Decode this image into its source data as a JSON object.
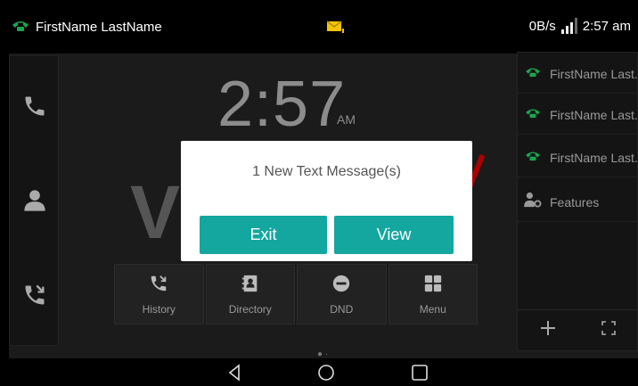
{
  "status_bar": {
    "account_name": "FirstName LastName",
    "net_speed": "0B/s",
    "time": "2:57 am"
  },
  "clock": {
    "time": "2:57",
    "ampm": "AM"
  },
  "dock": {
    "items": [
      {
        "label": "History",
        "icon": "history-icon"
      },
      {
        "label": "Directory",
        "icon": "directory-icon"
      },
      {
        "label": "DND",
        "icon": "dnd-icon"
      },
      {
        "label": "Menu",
        "icon": "menu-icon"
      }
    ]
  },
  "right_panel": {
    "line_keys": [
      {
        "label": "FirstName Last..."
      },
      {
        "label": "FirstName Last..."
      },
      {
        "label": "FirstName Last..."
      },
      {
        "label": "Features"
      }
    ]
  },
  "dialog": {
    "message": "1 New Text Message(s)",
    "exit_label": "Exit",
    "view_label": "View"
  },
  "colors": {
    "accent": "#13a7a0",
    "line_green": "#1aa550",
    "mail_yellow": "#f5c400"
  }
}
